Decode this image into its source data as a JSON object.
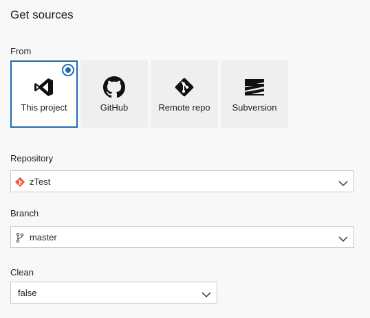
{
  "page": {
    "title": "Get sources"
  },
  "from": {
    "label": "From",
    "tiles": [
      {
        "label": "This project",
        "icon": "visual-studio-icon",
        "selected": true
      },
      {
        "label": "GitHub",
        "icon": "github-icon",
        "selected": false
      },
      {
        "label": "Remote repo",
        "icon": "git-icon",
        "selected": false
      },
      {
        "label": "Subversion",
        "icon": "subversion-icon",
        "selected": false
      }
    ]
  },
  "repository": {
    "label": "Repository",
    "value": "zTest",
    "icon": "git-repo-icon",
    "icon_color": "#e8543a"
  },
  "branch": {
    "label": "Branch",
    "value": "master",
    "icon": "branch-icon"
  },
  "clean": {
    "label": "Clean",
    "value": "false"
  },
  "colors": {
    "accent": "#1f6bb8",
    "tile_bg": "#efefef",
    "page_bg": "#f8f8f8"
  }
}
